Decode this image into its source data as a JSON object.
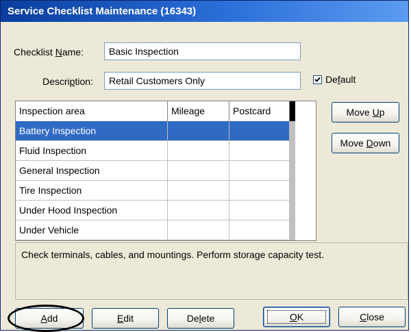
{
  "window": {
    "title": "Service Checklist Maintenance (16343)"
  },
  "form": {
    "name_label_pre": "Checklist ",
    "name_label_key": "N",
    "name_label_post": "ame:",
    "name_value": "Basic Inspection",
    "desc_label_pre": "Descri",
    "desc_label_key": "p",
    "desc_label_post": "tion:",
    "desc_value": "Retail Customers Only",
    "default_label_pre": "De",
    "default_label_key": "f",
    "default_label_post": "ault",
    "default_checked": true
  },
  "grid": {
    "columns": [
      "Inspection area",
      "Mileage",
      "Postcard"
    ],
    "rows": [
      {
        "area": "Battery Inspection",
        "mileage": "",
        "postcard": "",
        "selected": true
      },
      {
        "area": "Fluid Inspection",
        "mileage": "",
        "postcard": "",
        "selected": false
      },
      {
        "area": "General Inspection",
        "mileage": "",
        "postcard": "",
        "selected": false
      },
      {
        "area": "Tire Inspection",
        "mileage": "",
        "postcard": "",
        "selected": false
      },
      {
        "area": "Under Hood Inspection",
        "mileage": "",
        "postcard": "",
        "selected": false
      },
      {
        "area": "Under Vehicle",
        "mileage": "",
        "postcard": "",
        "selected": false
      }
    ]
  },
  "side_buttons": {
    "move_up_pre": "Move ",
    "move_up_key": "U",
    "move_up_post": "p",
    "move_down_pre": "Move ",
    "move_down_key": "D",
    "move_down_post": "own"
  },
  "area_description": "Check terminals, cables, and mountings. Perform storage capacity test.",
  "bottom_buttons": {
    "add_key": "A",
    "add_post": "dd",
    "edit_key": "E",
    "edit_post": "dit",
    "delete_pre": "De",
    "delete_key": "l",
    "delete_post": "ete",
    "ok_key": "O",
    "ok_post": "K",
    "close_key": "C",
    "close_post": "lose"
  },
  "colors": {
    "title_bar": "#2a6fd8",
    "selection": "#316ac5",
    "dialog_bg": "#ece9d8",
    "annotation": "#000000"
  }
}
